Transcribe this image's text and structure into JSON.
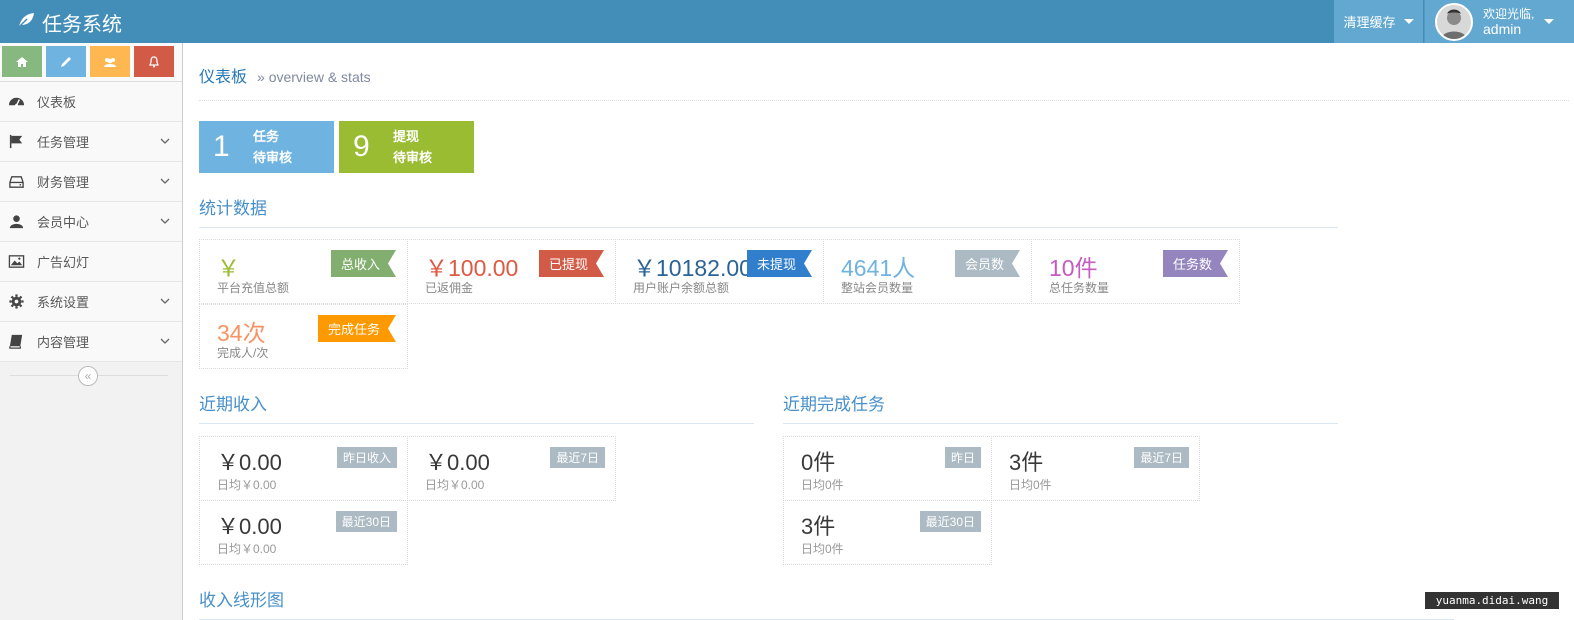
{
  "navbar": {
    "brand": "任务系统",
    "cache_label": "清理缓存",
    "welcome": "欢迎光临,",
    "username": "admin"
  },
  "sidebar": {
    "shortcuts": [
      {
        "icon": "home-icon",
        "color": "#87b87f"
      },
      {
        "icon": "pencil-icon",
        "color": "#6fb3e0"
      },
      {
        "icon": "users-icon",
        "color": "#ffb752"
      },
      {
        "icon": "bell-icon",
        "color": "#d15b47"
      }
    ],
    "items": [
      {
        "label": "仪表板",
        "icon": "dashboard-icon",
        "has_sub": false
      },
      {
        "label": "任务管理",
        "icon": "flag-icon",
        "has_sub": true
      },
      {
        "label": "财务管理",
        "icon": "hdd-icon",
        "has_sub": true
      },
      {
        "label": "会员中心",
        "icon": "user-icon",
        "has_sub": true
      },
      {
        "label": "广告幻灯",
        "icon": "picture-icon",
        "has_sub": false
      },
      {
        "label": "系统设置",
        "icon": "cog-icon",
        "has_sub": true
      },
      {
        "label": "内容管理",
        "icon": "book-icon",
        "has_sub": true
      }
    ],
    "collapse_glyph": "«"
  },
  "page": {
    "title": "仪表板",
    "subtitle": "» overview & stats"
  },
  "todos": [
    {
      "count": "1",
      "line1": "任务",
      "line2": "待审核",
      "color": "#6fb3e0"
    },
    {
      "count": "9",
      "line1": "提现",
      "line2": "待审核",
      "color": "#9abc32"
    }
  ],
  "stats_section": {
    "title": "统计数据",
    "cards": [
      {
        "value": "￥",
        "desc": "平台充值总额",
        "badge": "总收入",
        "value_color": "#9abc32",
        "badge_color": "#82af6f"
      },
      {
        "value": "￥100.00",
        "desc": "已返佣金",
        "badge": "已提现",
        "value_color": "#dd5a43",
        "badge_color": "#d15b47"
      },
      {
        "value": "￥10182.00",
        "desc": "用户账户余额总额",
        "badge": "未提现",
        "value_color": "#2a6496",
        "badge_color": "#307ecc"
      },
      {
        "value": "4641人",
        "desc": "整站会员数量",
        "badge": "会员数",
        "value_color": "#6fb3e0",
        "badge_color": "#abbac3"
      },
      {
        "value": "10件",
        "desc": "总任务数量",
        "badge": "任务数",
        "value_color": "#c45bc1",
        "badge_color": "#9585bf"
      },
      {
        "value": "34次",
        "desc": "完成人/次",
        "badge": "完成任务",
        "value_color": "#f79263",
        "badge_color": "#ff9900"
      }
    ]
  },
  "income_section": {
    "title": "近期收入",
    "cards": [
      {
        "value": "￥0.00",
        "tag": "昨日收入",
        "desc": "日均￥0.00"
      },
      {
        "value": "￥0.00",
        "tag": "最近7日",
        "desc": "日均￥0.00"
      },
      {
        "value": "￥0.00",
        "tag": "最近30日",
        "desc": "日均￥0.00"
      }
    ]
  },
  "task_section": {
    "title": "近期完成任务",
    "cards": [
      {
        "value": "0件",
        "tag": "昨日",
        "desc": "日均0件"
      },
      {
        "value": "3件",
        "tag": "最近7日",
        "desc": "日均0件"
      },
      {
        "value": "3件",
        "tag": "最近30日",
        "desc": "日均0件"
      }
    ]
  },
  "chart_section": {
    "title": "收入线形图"
  },
  "watermark": "yuanma.didai.wang"
}
